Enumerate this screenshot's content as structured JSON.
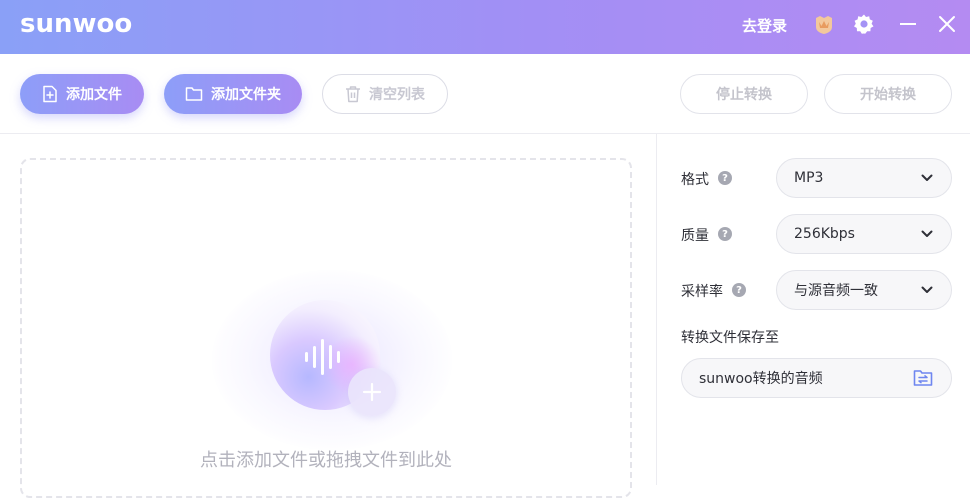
{
  "app": {
    "logo": "sunwoo",
    "login_label": "去登录",
    "icons": {
      "vip": "vip-crown-icon",
      "settings": "gear-icon",
      "minimize": "minimize-icon",
      "close": "close-icon"
    }
  },
  "toolbar": {
    "add_file": "添加文件",
    "add_folder": "添加文件夹",
    "clear_list": "清空列表",
    "stop_convert": "停止转换",
    "start_convert": "开始转换"
  },
  "dropzone": {
    "hint": "点击添加文件或拖拽文件到此处"
  },
  "settings": {
    "format_label": "格式",
    "format_value": "MP3",
    "quality_label": "质量",
    "quality_value": "256Kbps",
    "samplerate_label": "采样率",
    "samplerate_value": "与源音频一致",
    "save_label": "转换文件保存至",
    "save_path": "sunwoo转换的音频"
  },
  "colors": {
    "accent_start": "#8d9ef8",
    "accent_end": "#a88cf3",
    "folder_icon": "#6f86f0"
  }
}
